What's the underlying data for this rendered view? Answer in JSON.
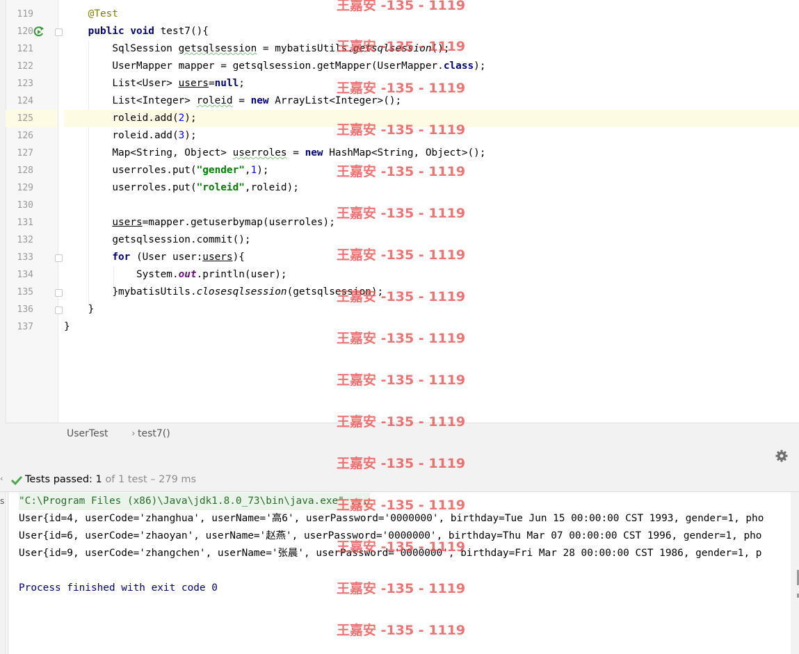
{
  "editor": {
    "line_numbers": [
      "119",
      "120",
      "121",
      "122",
      "123",
      "124",
      "125",
      "126",
      "127",
      "128",
      "129",
      "130",
      "131",
      "132",
      "133",
      "134",
      "135",
      "136",
      "137"
    ],
    "code": {
      "l119_ann": "@Test",
      "l120_kw1": "public",
      "l120_kw2": "void",
      "l120_rest": "test7(){",
      "l121_a": "SqlSession ",
      "l121_var": "getsqlsession",
      "l121_b": " = mybatisUtils.",
      "l121_call": "getsqlsession",
      "l121_c": "();",
      "l122_a": "UserMapper mapper = getsqlsession.getMapper(UserMapper.",
      "l122_kw": "class",
      "l122_b": ");",
      "l123_a": "List<User> ",
      "l123_var": "users",
      "l123_b": "=",
      "l123_kw": "null",
      "l123_c": ";",
      "l124_a": "List<Integer> ",
      "l124_var": "roleid",
      "l124_b": " = ",
      "l124_kw": "new",
      "l124_c": " ArrayList<Integer>();",
      "l125_a": "roleid.add(",
      "l125_num": "2",
      "l125_b": ");",
      "l126_a": "roleid.add(",
      "l126_num": "3",
      "l126_b": ");",
      "l127_a": "Map<String, Object> ",
      "l127_var": "userroles",
      "l127_b": " = ",
      "l127_kw": "new",
      "l127_c": " HashMap<String, Object>();",
      "l128_a": "userroles.put(",
      "l128_str": "\"gender\"",
      "l128_b": ",",
      "l128_num": "1",
      "l128_c": ");",
      "l129_a": "userroles.put(",
      "l129_str": "\"roleid\"",
      "l129_b": ",roleid);",
      "l131_var": "users",
      "l131_rest": "=mapper.getuserbymap(userroles);",
      "l132": "getsqlsession.commit();",
      "l133_kw": "for",
      "l133_a": " (User user:",
      "l133_var": "users",
      "l133_b": "){",
      "l134_a": "System.",
      "l134_field": "out",
      "l134_b": ".println(user);",
      "l135_a": "}mybatisUtils.",
      "l135_call": "closesqlsession",
      "l135_b": "(getsqlsession);",
      "l136": "}",
      "l137": "}"
    }
  },
  "breadcrumb": {
    "class_name": "UserTest",
    "separator": "›",
    "method_name": "test7()"
  },
  "run_panel": {
    "status_passed": "Tests passed:",
    "status_count": "1",
    "status_rest": "of 1 test – 279 ms",
    "left_cut_label": "s"
  },
  "console": {
    "command": "\"C:\\Program Files (x86)\\Java\\jdk1.8.0_73\\bin\\java.exe\" ...",
    "lines": [
      "User{id=4, userCode='zhanghua', userName='高6', userPassword='0000000', birthday=Tue Jun 15 00:00:00 CST 1993, gender=1, pho",
      "User{id=6, userCode='zhaoyan', userName='赵燕', userPassword='0000000', birthday=Thu Mar 07 00:00:00 CST 1996, gender=1, pho",
      "User{id=9, userCode='zhangchen', userName='张晨', userPassword='0000000', birthday=Fri Mar 28 00:00:00 CST 1986, gender=1, p"
    ],
    "exit_line": "Process finished with exit code 0"
  },
  "watermark": {
    "text": "王嘉安 -135 - 1119"
  },
  "colors": {
    "keyword": "#000080",
    "string": "#008000",
    "number": "#0000ff",
    "annotation": "#808000",
    "exit_text": "#000080",
    "watermark": "#eb4b4b",
    "pass_check": "#4aa84a"
  },
  "icons": [
    "run-test-icon",
    "intention-bulb-icon",
    "fold-icon",
    "gear-icon",
    "check-icon"
  ]
}
